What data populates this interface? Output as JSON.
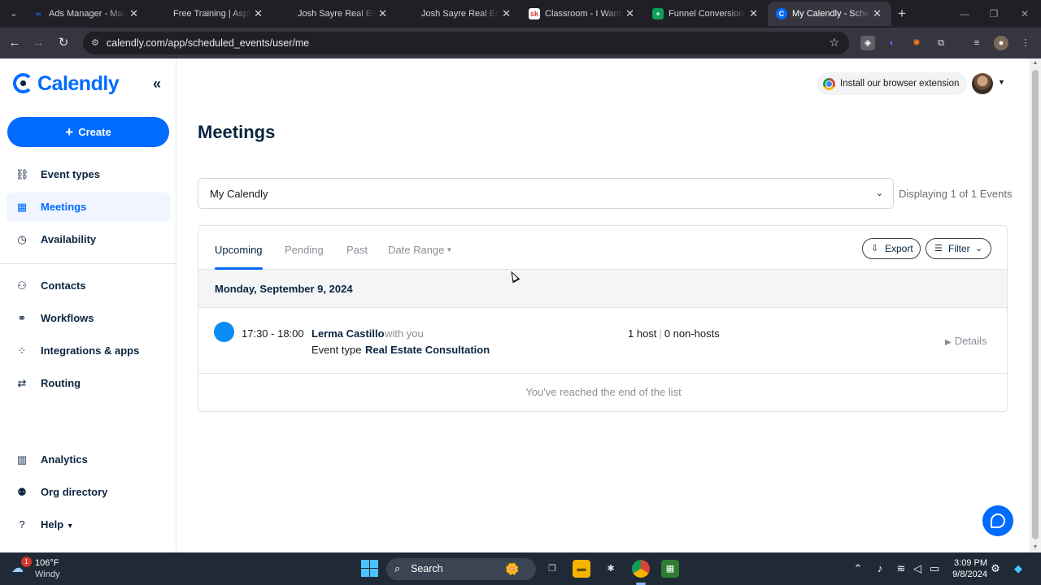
{
  "browser": {
    "tabs": [
      {
        "title": "Ads Manager - Manage ads",
        "favicon": "meta-icon",
        "fav_color": "#1877f2",
        "fav_glyph": "∞"
      },
      {
        "title": "Free Training | Aspiring",
        "favicon": "blank-icon",
        "fav_color": "#1f1f25",
        "fav_glyph": ""
      },
      {
        "title": "Josh Sayre Real Estate",
        "favicon": "blank-icon",
        "fav_color": "#1f1f25",
        "fav_glyph": ""
      },
      {
        "title": "Josh Sayre Real Estate",
        "favicon": "blank-icon",
        "fav_color": "#1f1f25",
        "fav_glyph": ""
      },
      {
        "title": "Classroom - I Want My",
        "favicon": "skool-icon",
        "fav_color": "#ffffff",
        "fav_glyph": "sk"
      },
      {
        "title": "Funnel Conversion Rates",
        "favicon": "sheets-icon",
        "fav_color": "#0f9d58",
        "fav_glyph": "+"
      },
      {
        "title": "My Calendly - Scheduled",
        "favicon": "calendly-icon",
        "fav_color": "#006bff",
        "fav_glyph": "C"
      }
    ],
    "url": "calendly.com/app/scheduled_events/user/me"
  },
  "sidebar": {
    "logo_text": "Calendly",
    "create_label": "Create",
    "items": [
      {
        "label": "Event types",
        "icon": "link-icon",
        "glyph": "⛓"
      },
      {
        "label": "Meetings",
        "icon": "calendar-icon",
        "glyph": "▦"
      },
      {
        "label": "Availability",
        "icon": "clock-icon",
        "glyph": "◷"
      },
      {
        "label": "Contacts",
        "icon": "contacts-icon",
        "glyph": "👥"
      },
      {
        "label": "Workflows",
        "icon": "workflows-icon",
        "glyph": "⚭"
      },
      {
        "label": "Integrations & apps",
        "icon": "apps-grid-icon",
        "glyph": "⁘"
      },
      {
        "label": "Routing",
        "icon": "routing-icon",
        "glyph": "⇄"
      },
      {
        "label": "Analytics",
        "icon": "analytics-icon",
        "glyph": "▥"
      },
      {
        "label": "Org directory",
        "icon": "org-directory-icon",
        "glyph": "👤"
      },
      {
        "label": "Help",
        "icon": "help-icon",
        "glyph": "?"
      }
    ]
  },
  "header": {
    "extension_label": "Install our browser extension"
  },
  "main": {
    "title": "Meetings",
    "calendar_select": "My Calendly",
    "displaying": "Displaying 1 of 1 Events",
    "tabs": [
      "Upcoming",
      "Pending",
      "Past",
      "Date Range"
    ],
    "export_label": "Export",
    "filter_label": "Filter",
    "date_heading": "Monday, September 9, 2024",
    "event": {
      "time": "17:30 - 18:00",
      "invitee": "Lerma Castillo",
      "with": "with you",
      "type_label": "Event type",
      "type_value": "Real Estate Consultation",
      "hosts": "1 host",
      "non_hosts": "0 non-hosts",
      "details_label": "Details",
      "dot_color": "#0a8bf5"
    },
    "end_message": "You've reached the end of the list"
  },
  "taskbar": {
    "temperature": "106°F",
    "condition": "Windy",
    "weather_badge": "1",
    "search_label": "Search",
    "time": "3:09 PM",
    "date": "9/8/2024"
  },
  "colors": {
    "brand": "#006bff",
    "nav_text": "#0a2540"
  }
}
